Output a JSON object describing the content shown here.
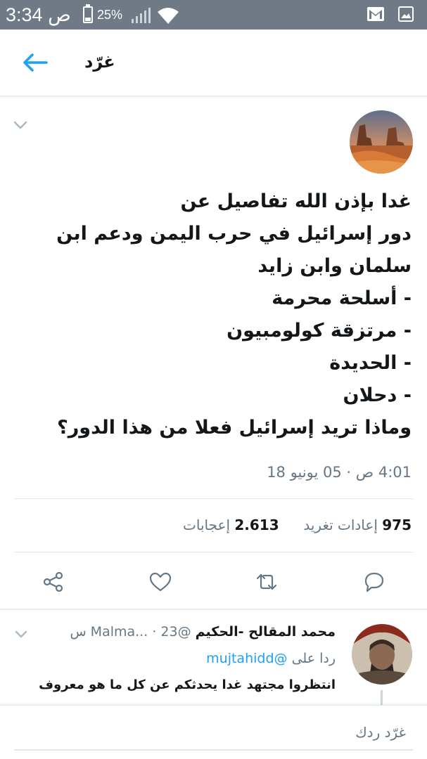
{
  "status_bar": {
    "time": "3:34 ص",
    "battery": "25%"
  },
  "header": {
    "title": "غرّد"
  },
  "tweet": {
    "lines": [
      "غدا بإذن الله تفاصيل عن",
      "دور إسرائيل في حرب اليمن ودعم ابن",
      "سلمان وابن زايد",
      "- أسلحة محرمة",
      "- مرتزقة كولومبيون",
      "- الحديدة",
      "- دحلان",
      "وماذا تريد إسرائيل فعلا من هذا الدور؟"
    ],
    "timestamp": "4:01 ص · 05 يونيو 18",
    "retweets_count": "975",
    "retweets_label": "إعادات تغريد",
    "likes_count": "2.613",
    "likes_label": "إعجابات"
  },
  "reply": {
    "name": "محمد المقالح -الحكيم",
    "handle": "@Malma...",
    "time": "23 س",
    "replying_prefix": "ردا على",
    "replying_to": "@mujtahidd",
    "text": "انتظروا مجتهد غدا يحدثكم عن كل ما هو معروف"
  },
  "compose": {
    "placeholder": "غرّد ردك"
  },
  "icons": {
    "back": "arrow-left-icon",
    "accent": "#1da1f2",
    "action_gray": "#657786"
  }
}
